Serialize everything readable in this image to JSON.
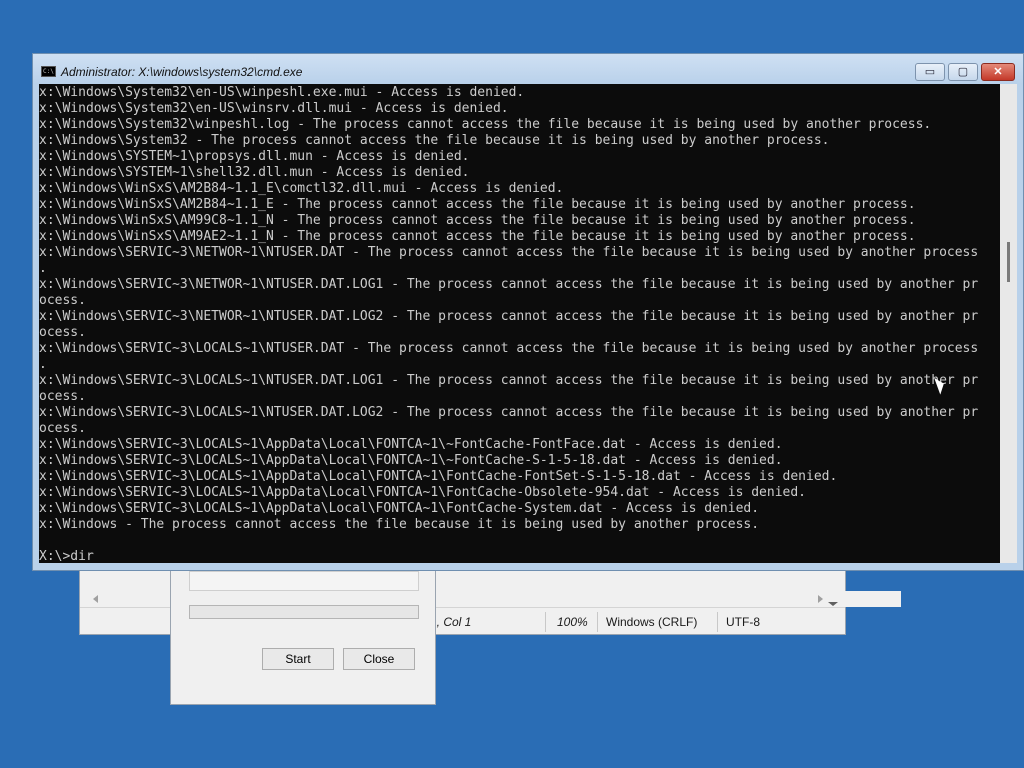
{
  "bg_editor": {
    "status": {
      "position": "1, Col 1",
      "zoom": "100%",
      "line_endings": "Windows (CRLF)",
      "encoding": "UTF-8"
    }
  },
  "bg_dialog": {
    "start_label": "Start",
    "close_label": "Close"
  },
  "cmd": {
    "title": "Administrator: X:\\windows\\system32\\cmd.exe",
    "icon_text": "C:\\",
    "minimize_label": "▭",
    "maximize_label": "▢",
    "close_label": "✕",
    "lines": [
      "x:\\Windows\\System32\\en-US\\winpeshl.exe.mui - Access is denied.",
      "x:\\Windows\\System32\\en-US\\winsrv.dll.mui - Access is denied.",
      "x:\\Windows\\System32\\winpeshl.log - The process cannot access the file because it is being used by another process.",
      "x:\\Windows\\System32 - The process cannot access the file because it is being used by another process.",
      "x:\\Windows\\SYSTEM~1\\propsys.dll.mun - Access is denied.",
      "x:\\Windows\\SYSTEM~1\\shell32.dll.mun - Access is denied.",
      "x:\\Windows\\WinSxS\\AM2B84~1.1_E\\comctl32.dll.mui - Access is denied.",
      "x:\\Windows\\WinSxS\\AM2B84~1.1_E - The process cannot access the file because it is being used by another process.",
      "x:\\Windows\\WinSxS\\AM99C8~1.1_N - The process cannot access the file because it is being used by another process.",
      "x:\\Windows\\WinSxS\\AM9AE2~1.1_N - The process cannot access the file because it is being used by another process.",
      "x:\\Windows\\SERVIC~3\\NETWOR~1\\NTUSER.DAT - The process cannot access the file because it is being used by another process",
      ".",
      "x:\\Windows\\SERVIC~3\\NETWOR~1\\NTUSER.DAT.LOG1 - The process cannot access the file because it is being used by another pr",
      "ocess.",
      "x:\\Windows\\SERVIC~3\\NETWOR~1\\NTUSER.DAT.LOG2 - The process cannot access the file because it is being used by another pr",
      "ocess.",
      "x:\\Windows\\SERVIC~3\\LOCALS~1\\NTUSER.DAT - The process cannot access the file because it is being used by another process",
      ".",
      "x:\\Windows\\SERVIC~3\\LOCALS~1\\NTUSER.DAT.LOG1 - The process cannot access the file because it is being used by another pr",
      "ocess.",
      "x:\\Windows\\SERVIC~3\\LOCALS~1\\NTUSER.DAT.LOG2 - The process cannot access the file because it is being used by another pr",
      "ocess.",
      "x:\\Windows\\SERVIC~3\\LOCALS~1\\AppData\\Local\\FONTCA~1\\~FontCache-FontFace.dat - Access is denied.",
      "x:\\Windows\\SERVIC~3\\LOCALS~1\\AppData\\Local\\FONTCA~1\\~FontCache-S-1-5-18.dat - Access is denied.",
      "x:\\Windows\\SERVIC~3\\LOCALS~1\\AppData\\Local\\FONTCA~1\\FontCache-FontSet-S-1-5-18.dat - Access is denied.",
      "x:\\Windows\\SERVIC~3\\LOCALS~1\\AppData\\Local\\FONTCA~1\\FontCache-Obsolete-954.dat - Access is denied.",
      "x:\\Windows\\SERVIC~3\\LOCALS~1\\AppData\\Local\\FONTCA~1\\FontCache-System.dat - Access is denied.",
      "x:\\Windows - The process cannot access the file because it is being used by another process.",
      "",
      "X:\\>dir"
    ]
  },
  "colors": {
    "desktop": "#2a6db5",
    "console_bg": "#0c0c0c",
    "console_text": "#cccccc"
  }
}
